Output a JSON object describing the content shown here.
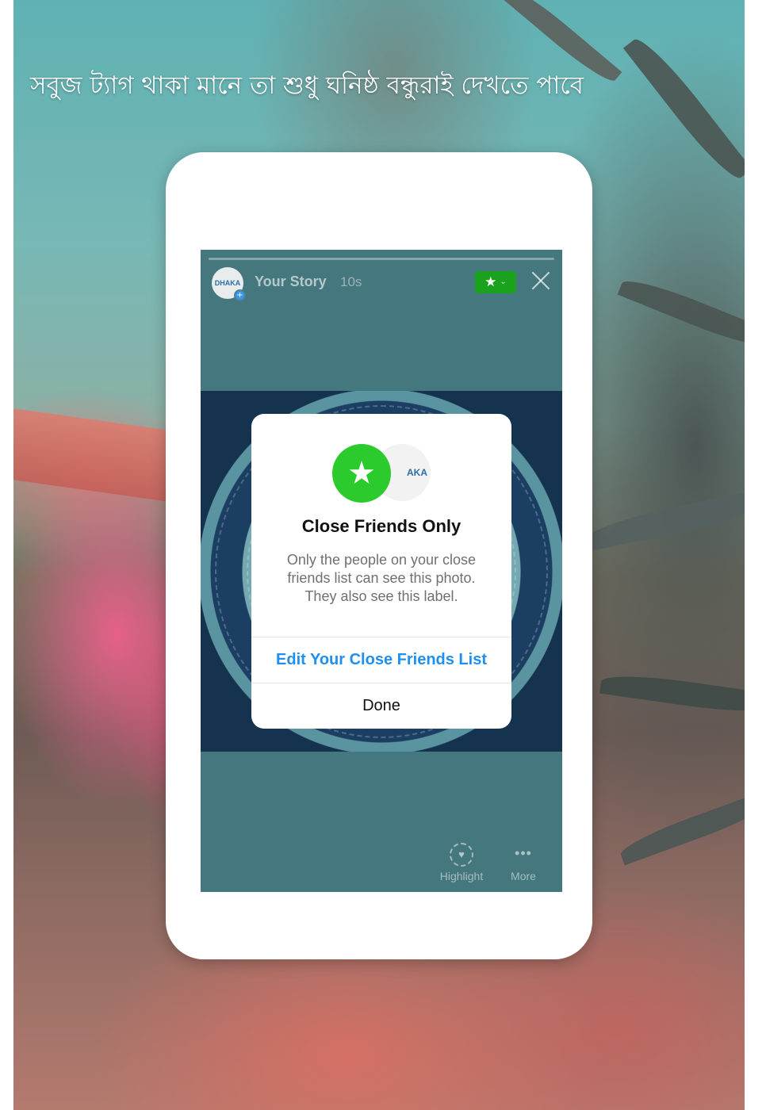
{
  "caption": "সবুজ ট্যাগ থাকা মানে তা শুধু ঘনিষ্ঠ বন্ধুরাই দেখতে পাবে",
  "story": {
    "avatar_logo_text": "DHAKA",
    "title": "Your Story",
    "time": "10s",
    "badge_icon": "star-icon",
    "actions": {
      "highlight": "Highlight",
      "more": "More"
    }
  },
  "dialog": {
    "profile_logo_text": "AKA",
    "title": "Close Friends Only",
    "body": "Only the people on your close friends list can see this photo. They also see this label.",
    "edit_button": "Edit Your Close Friends List",
    "done_button": "Done"
  },
  "colors": {
    "close_friends_green": "#2bcb2d",
    "badge_green": "#1aa11d",
    "link_blue": "#1f8ff0"
  }
}
